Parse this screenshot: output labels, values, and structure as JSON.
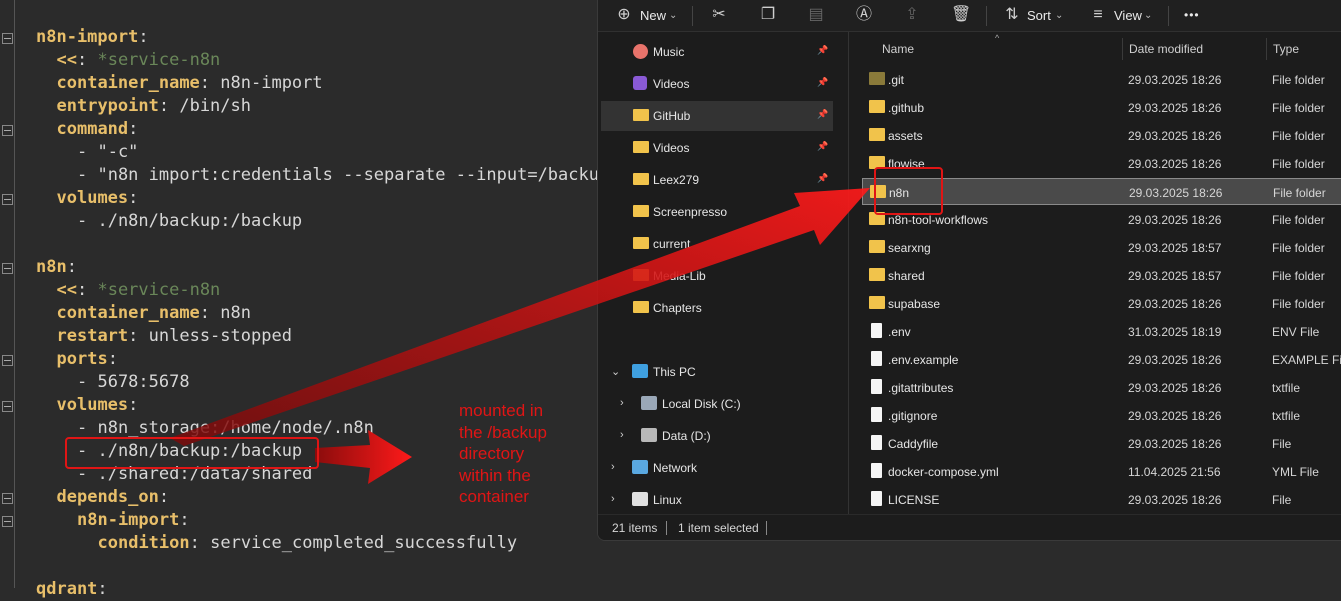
{
  "editor": {
    "lines": [
      {
        "indent": "",
        "key": "n8n-import",
        "sep": ":",
        "val": ""
      },
      {
        "indent": "  ",
        "key": "<<",
        "sep": ": ",
        "ref": "*service-n8n"
      },
      {
        "indent": "  ",
        "key": "container_name",
        "sep": ": ",
        "val": "n8n-import"
      },
      {
        "indent": "  ",
        "key": "entrypoint",
        "sep": ": ",
        "val": "/bin/sh"
      },
      {
        "indent": "  ",
        "key": "command",
        "sep": ":",
        "val": ""
      },
      {
        "indent": "    ",
        "key": "",
        "sep": "",
        "val": "- \"-c\""
      },
      {
        "indent": "    ",
        "key": "",
        "sep": "",
        "val": "- \"n8n import:credentials --separate --input=/backu"
      },
      {
        "indent": "  ",
        "key": "volumes",
        "sep": ":",
        "val": ""
      },
      {
        "indent": "    ",
        "key": "",
        "sep": "",
        "val": "- ./n8n/backup:/backup"
      },
      {
        "indent": "",
        "key": "",
        "sep": "",
        "val": ""
      },
      {
        "indent": "",
        "key": "n8n",
        "sep": ":",
        "val": ""
      },
      {
        "indent": "  ",
        "key": "<<",
        "sep": ": ",
        "ref": "*service-n8n"
      },
      {
        "indent": "  ",
        "key": "container_name",
        "sep": ": ",
        "val": "n8n"
      },
      {
        "indent": "  ",
        "key": "restart",
        "sep": ": ",
        "val": "unless-stopped"
      },
      {
        "indent": "  ",
        "key": "ports",
        "sep": ":",
        "val": ""
      },
      {
        "indent": "    ",
        "key": "",
        "sep": "",
        "val": "- 5678:5678"
      },
      {
        "indent": "  ",
        "key": "volumes",
        "sep": ":",
        "val": ""
      },
      {
        "indent": "    ",
        "key": "",
        "sep": "",
        "val": "- n8n_storage:/home/node/.n8n"
      },
      {
        "indent": "    ",
        "key": "",
        "sep": "",
        "val": "- ./n8n/backup:/backup"
      },
      {
        "indent": "    ",
        "key": "",
        "sep": "",
        "val": "- ./shared:/data/shared"
      },
      {
        "indent": "  ",
        "key": "depends_on",
        "sep": ":",
        "val": ""
      },
      {
        "indent": "    ",
        "key": "n8n-import",
        "sep": ":",
        "val": ""
      },
      {
        "indent": "      ",
        "key": "condition",
        "sep": ": ",
        "val": "service_completed_successfully"
      },
      {
        "indent": "",
        "key": "",
        "sep": "",
        "val": ""
      },
      {
        "indent": "",
        "key": "qdrant",
        "sep": ":",
        "val": ""
      }
    ],
    "annotation": "mounted in\nthe /backup\ndirectory\nwithin the\ncontainer"
  },
  "toolbar": {
    "new_label": "New",
    "sort_label": "Sort",
    "view_label": "View",
    "more_label": "•••"
  },
  "nav": {
    "quick": [
      {
        "label": "Music",
        "icon": "music-icon",
        "pinned": true
      },
      {
        "label": "Videos",
        "icon": "videos-icon",
        "pinned": true
      },
      {
        "label": "GitHub",
        "icon": "folder-icon",
        "pinned": true,
        "selected": true
      },
      {
        "label": "Videos",
        "icon": "folder-icon",
        "pinned": true
      },
      {
        "label": "Leex279",
        "icon": "folder-icon",
        "pinned": true
      },
      {
        "label": "Screenpresso",
        "icon": "folder-icon",
        "pinned": false
      },
      {
        "label": "current",
        "icon": "folder-icon",
        "pinned": false
      },
      {
        "label": "Media-Lib",
        "icon": "folder-icon",
        "pinned": false
      },
      {
        "label": "Chapters",
        "icon": "folder-icon",
        "pinned": false
      }
    ],
    "this_pc": "This PC",
    "drives": [
      "Local Disk (C:)",
      "Data (D:)"
    ],
    "network": "Network",
    "linux": "Linux"
  },
  "columns": {
    "name": "Name",
    "date": "Date modified",
    "type": "Type"
  },
  "files": [
    {
      "name": ".git",
      "date": "29.03.2025 18:26",
      "type": "File folder",
      "kind": "folder-dim"
    },
    {
      "name": ".github",
      "date": "29.03.2025 18:26",
      "type": "File folder",
      "kind": "folder"
    },
    {
      "name": "assets",
      "date": "29.03.2025 18:26",
      "type": "File folder",
      "kind": "folder"
    },
    {
      "name": "flowise",
      "date": "29.03.2025 18:26",
      "type": "File folder",
      "kind": "folder"
    },
    {
      "name": "n8n",
      "date": "29.03.2025 18:26",
      "type": "File folder",
      "kind": "folder",
      "selected": true
    },
    {
      "name": "n8n-tool-workflows",
      "date": "29.03.2025 18:26",
      "type": "File folder",
      "kind": "folder"
    },
    {
      "name": "searxng",
      "date": "29.03.2025 18:57",
      "type": "File folder",
      "kind": "folder"
    },
    {
      "name": "shared",
      "date": "29.03.2025 18:57",
      "type": "File folder",
      "kind": "folder"
    },
    {
      "name": "supabase",
      "date": "29.03.2025 18:26",
      "type": "File folder",
      "kind": "folder"
    },
    {
      "name": ".env",
      "date": "31.03.2025 18:19",
      "type": "ENV File",
      "kind": "file"
    },
    {
      "name": ".env.example",
      "date": "29.03.2025 18:26",
      "type": "EXAMPLE File",
      "kind": "file"
    },
    {
      "name": ".gitattributes",
      "date": "29.03.2025 18:26",
      "type": "txtfile",
      "kind": "file"
    },
    {
      "name": ".gitignore",
      "date": "29.03.2025 18:26",
      "type": "txtfile",
      "kind": "file"
    },
    {
      "name": "Caddyfile",
      "date": "29.03.2025 18:26",
      "type": "File",
      "kind": "file"
    },
    {
      "name": "docker-compose.yml",
      "date": "11.04.2025 21:56",
      "type": "YML File",
      "kind": "file"
    },
    {
      "name": "LICENSE",
      "date": "29.03.2025 18:26",
      "type": "File",
      "kind": "file"
    }
  ],
  "status": {
    "count": "21 items",
    "selected": "1 item selected"
  }
}
